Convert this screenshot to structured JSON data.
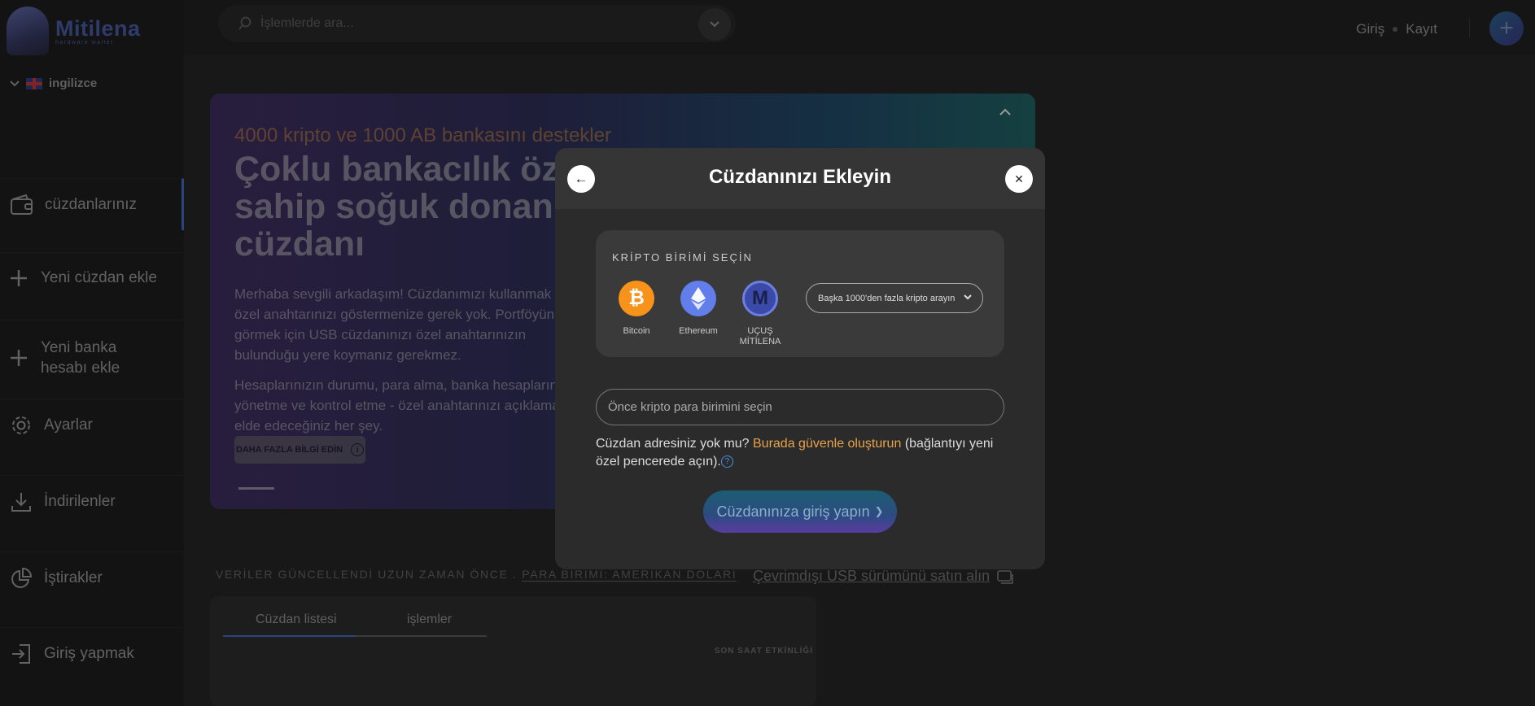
{
  "app": {
    "logo_name": "Mitilena",
    "logo_sub": "hardware wallet"
  },
  "language": {
    "label": "ingilizce"
  },
  "sidebar": {
    "items": [
      {
        "label": "cüzdanlarınız"
      },
      {
        "label": "Yeni cüzdan ekle"
      },
      {
        "label": "Yeni banka hesabı ekle"
      },
      {
        "label": "Ayarlar"
      },
      {
        "label": "İndirilenler"
      },
      {
        "label": "İştirakler"
      },
      {
        "label": "Giriş yapmak"
      }
    ]
  },
  "topbar": {
    "search_placeholder": "İşlemlerde ara...",
    "login": "Giriş",
    "register": "Kayıt",
    "plus": "+"
  },
  "hero": {
    "subtitle": "4000 kripto ve 1000 AB bankasını destekler",
    "title": "Çoklu bankacılık özelliklerine sahip soğuk donanım kripto cüzdanı",
    "body1": "Merhaba sevgili arkadaşım! Cüzdanımızı kullanmak için özel anahtarınızı göstermenize gerek yok. Portföyünüzü görmek için USB cüzdanınızı özel anahtarınızın bulunduğu yere koymanız gerekmez.",
    "body2": "Hesaplarınızın durumu, para alma, banka hesaplarını yönetme ve kontrol etme - özel anahtarınızı açıklamadan elde edeceğiniz her şey.",
    "button": "DAHA FAZLA BİLGİ EDİN",
    "info_icon": "i"
  },
  "status": {
    "updated": "VERİLER GÜNCELLENDİ UZUN ZAMAN ÖNCE .",
    "currency": "PARA BİRİMİ: AMERİKAN DOLARI"
  },
  "usb_link": "Çevrimdışı USB sürümünü satın alın",
  "wallet_panel": {
    "tabs": [
      "Cüzdan listesi",
      "işlemler"
    ],
    "last_hour": "SON SAAT ETKİNLİĞİ"
  },
  "modal": {
    "title": "Cüzdanınızı Ekleyin",
    "back_icon": "←",
    "close_icon": "✕",
    "crypto_label": "KRİPTO BİRİMİ SEÇİN",
    "coins": [
      {
        "name": "Bitcoin",
        "symbol": "₿",
        "color": "#f7931a"
      },
      {
        "name": "Ethereum",
        "symbol": "◆",
        "color": "#627eea"
      },
      {
        "name": "UÇUŞ MİTİLENA",
        "symbol": "M",
        "color": "#3b4aa8"
      }
    ],
    "select_placeholder": "Başka 1000'den fazla kripto arayın",
    "address_placeholder": "Önce kripto para birimini seçin",
    "note_pre": "Cüzdan adresiniz yok mu?",
    "note_link": "Burada güvenle oluşturun",
    "note_post": "(bağlantıyı yeni özel pencerede açın).",
    "help_icon": "?",
    "login_button": "Cüzdanınıza giriş yapın",
    "login_arrow": "❯"
  }
}
